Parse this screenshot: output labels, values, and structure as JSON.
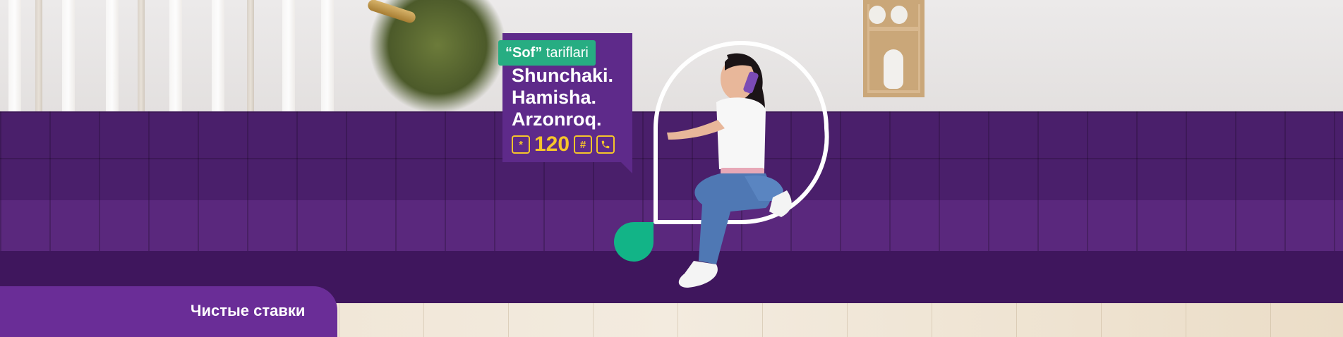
{
  "banner": {
    "tag": {
      "quoted": "“Sof”",
      "rest": "tariflari"
    },
    "lines": [
      "Shunchaki.",
      "Hamisha.",
      "Arzonroq."
    ],
    "ussd": {
      "prefix_symbol": "*",
      "number": "120",
      "hash_symbol": "#",
      "call_icon": "phone-icon"
    },
    "tab_label": "Чистые ставки"
  },
  "colors": {
    "brand_purple": "#5e2a8a",
    "tab_purple": "#6a2d97",
    "tag_green": "#27ad82",
    "dot_green": "#12b487",
    "ussd_yellow": "#f6c52a"
  }
}
